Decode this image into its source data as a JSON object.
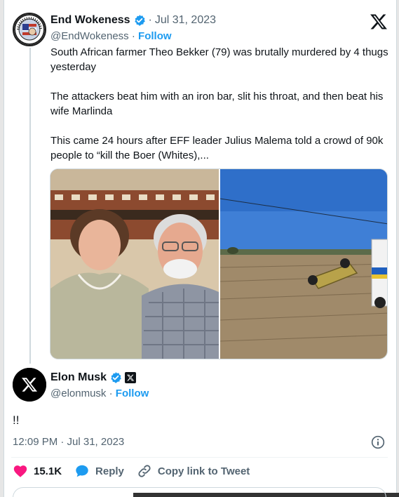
{
  "tweet": {
    "author": {
      "name": "End Wokeness",
      "handle": "@EndWokeness",
      "verified": true,
      "follow_label": "Follow",
      "separator": "·",
      "date": "Jul 31, 2023"
    },
    "text": [
      "South African farmer Theo Bekker (79) was brutally murdered by 4 thugs yesterday",
      "The attackers beat him with an iron bar, slit his throat, and then beat his wife Marlinda",
      "This came 24 hours after EFF leader Julius Malema told a crowd of 90k people to “kill the Boer (Whites),..."
    ],
    "media": [
      {
        "kind": "photo",
        "icon": "photo-elderly-couple"
      },
      {
        "kind": "photo",
        "icon": "photo-overturned-car"
      }
    ]
  },
  "reply": {
    "author": {
      "name": "Elon Musk",
      "handle": "@elonmusk",
      "verified": true,
      "affiliate_badge": "x-badge",
      "follow_label": "Follow",
      "separator": "·"
    },
    "text": "!!",
    "timestamp": "12:09 PM · Jul 31, 2023"
  },
  "actions": {
    "like_count": "15.1K",
    "reply_label": "Reply",
    "copy_label": "Copy link to Tweet"
  },
  "colors": {
    "accent": "#1d9bf0",
    "like": "#f91880",
    "text": "#0f1419",
    "muted": "#536471"
  }
}
